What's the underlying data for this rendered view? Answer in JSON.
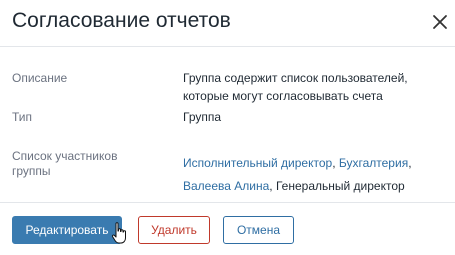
{
  "dialog": {
    "title": "Согласование отчетов",
    "close_icon": "close-icon"
  },
  "fields": {
    "description_label": "Описание",
    "description_line1": "Группа содержит список пользователей,",
    "description_line2": "которые могут согласовывать счета",
    "type_label": "Тип",
    "type_value": "Группа",
    "members_label_line1": "Список участников",
    "members_label_line2": "группы",
    "members": {
      "member1": "Исполнительный директор",
      "sep1": ", ",
      "member2": "Бухгалтерия",
      "sep2": ",",
      "member3": "Валеева Алина",
      "sep3": ", ",
      "member4": "Генеральный директор"
    }
  },
  "footer": {
    "edit_label": "Редактировать",
    "delete_label": "Удалить",
    "cancel_label": "Отмена"
  },
  "colors": {
    "primary": "#3a7bb0",
    "link": "#2f6ea3",
    "danger": "#c0392b"
  },
  "cursor_icon": "hand-pointer-icon"
}
